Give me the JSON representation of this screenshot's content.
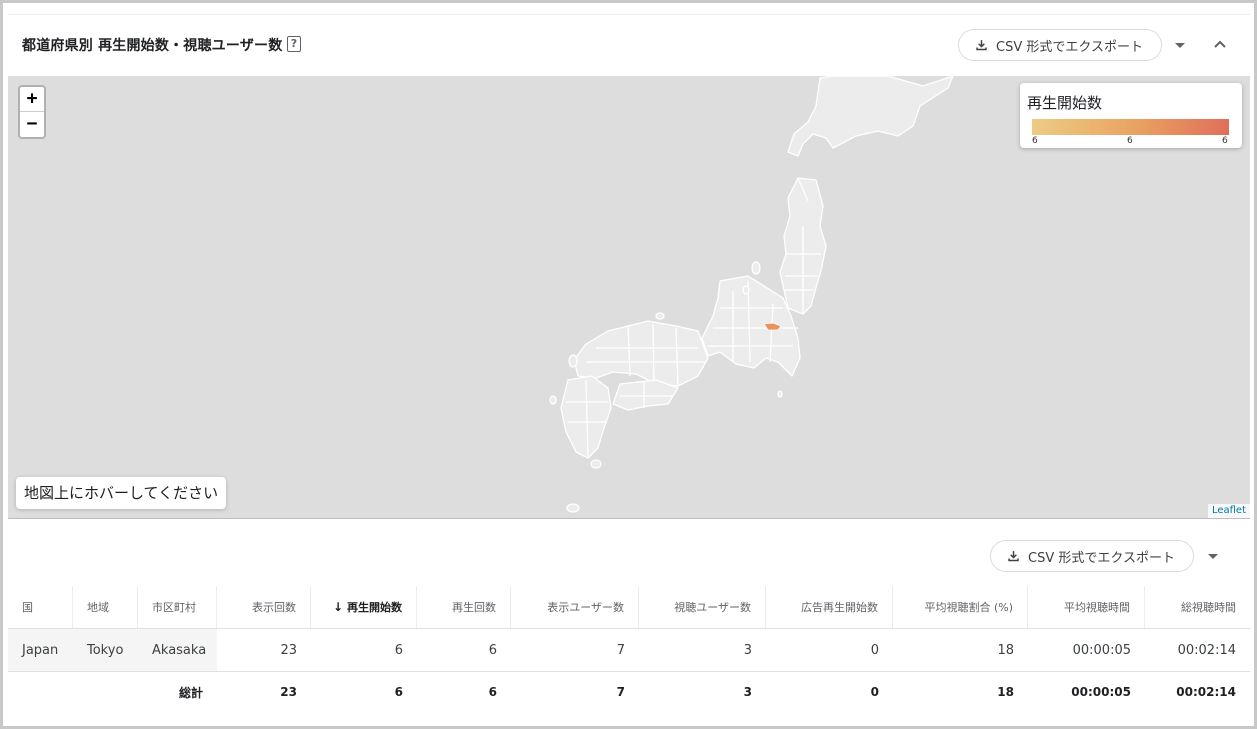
{
  "header": {
    "title": "都道府県別 再生開始数・視聴ユーザー数",
    "help_icon": "question-icon",
    "export_label": "CSV 形式でエクスポート"
  },
  "map": {
    "zoom_in": "+",
    "zoom_out": "−",
    "legend": {
      "title": "再生開始数",
      "min": "6",
      "mid": "6",
      "max": "6",
      "color_low": "#eccc84",
      "color_high": "#e06f5a"
    },
    "hover_hint": "地図上にホバーしてください",
    "attribution": "Leaflet",
    "highlighted_region": "Tokyo",
    "highlight_color": "#e8935d"
  },
  "table": {
    "export_label": "CSV 形式でエクスポート",
    "columns": [
      "国",
      "地域",
      "市区町村",
      "表示回数",
      "再生開始数",
      "再生回数",
      "表示ユーザー数",
      "視聴ユーザー数",
      "広告再生開始数",
      "平均視聴割合 (%)",
      "平均視聴時間",
      "総視聴時間"
    ],
    "sort_arrow": "↓",
    "rows": [
      [
        "Japan",
        "Tokyo",
        "Akasaka",
        "23",
        "6",
        "6",
        "7",
        "3",
        "0",
        "18",
        "00:00:05",
        "00:02:14"
      ]
    ],
    "total": {
      "label": "総計",
      "values": [
        "23",
        "6",
        "6",
        "7",
        "3",
        "0",
        "18",
        "00:00:05",
        "00:02:14"
      ]
    }
  }
}
